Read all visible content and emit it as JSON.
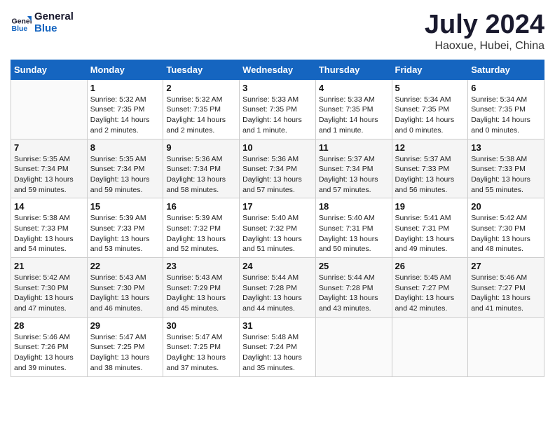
{
  "logo": {
    "line1": "General",
    "line2": "Blue"
  },
  "title": "July 2024",
  "subtitle": "Haoxue, Hubei, China",
  "weekdays": [
    "Sunday",
    "Monday",
    "Tuesday",
    "Wednesday",
    "Thursday",
    "Friday",
    "Saturday"
  ],
  "weeks": [
    [
      {
        "day": "",
        "info": ""
      },
      {
        "day": "1",
        "info": "Sunrise: 5:32 AM\nSunset: 7:35 PM\nDaylight: 14 hours\nand 2 minutes."
      },
      {
        "day": "2",
        "info": "Sunrise: 5:32 AM\nSunset: 7:35 PM\nDaylight: 14 hours\nand 2 minutes."
      },
      {
        "day": "3",
        "info": "Sunrise: 5:33 AM\nSunset: 7:35 PM\nDaylight: 14 hours\nand 1 minute."
      },
      {
        "day": "4",
        "info": "Sunrise: 5:33 AM\nSunset: 7:35 PM\nDaylight: 14 hours\nand 1 minute."
      },
      {
        "day": "5",
        "info": "Sunrise: 5:34 AM\nSunset: 7:35 PM\nDaylight: 14 hours\nand 0 minutes."
      },
      {
        "day": "6",
        "info": "Sunrise: 5:34 AM\nSunset: 7:35 PM\nDaylight: 14 hours\nand 0 minutes."
      }
    ],
    [
      {
        "day": "7",
        "info": "Sunrise: 5:35 AM\nSunset: 7:34 PM\nDaylight: 13 hours\nand 59 minutes."
      },
      {
        "day": "8",
        "info": "Sunrise: 5:35 AM\nSunset: 7:34 PM\nDaylight: 13 hours\nand 59 minutes."
      },
      {
        "day": "9",
        "info": "Sunrise: 5:36 AM\nSunset: 7:34 PM\nDaylight: 13 hours\nand 58 minutes."
      },
      {
        "day": "10",
        "info": "Sunrise: 5:36 AM\nSunset: 7:34 PM\nDaylight: 13 hours\nand 57 minutes."
      },
      {
        "day": "11",
        "info": "Sunrise: 5:37 AM\nSunset: 7:34 PM\nDaylight: 13 hours\nand 57 minutes."
      },
      {
        "day": "12",
        "info": "Sunrise: 5:37 AM\nSunset: 7:33 PM\nDaylight: 13 hours\nand 56 minutes."
      },
      {
        "day": "13",
        "info": "Sunrise: 5:38 AM\nSunset: 7:33 PM\nDaylight: 13 hours\nand 55 minutes."
      }
    ],
    [
      {
        "day": "14",
        "info": "Sunrise: 5:38 AM\nSunset: 7:33 PM\nDaylight: 13 hours\nand 54 minutes."
      },
      {
        "day": "15",
        "info": "Sunrise: 5:39 AM\nSunset: 7:33 PM\nDaylight: 13 hours\nand 53 minutes."
      },
      {
        "day": "16",
        "info": "Sunrise: 5:39 AM\nSunset: 7:32 PM\nDaylight: 13 hours\nand 52 minutes."
      },
      {
        "day": "17",
        "info": "Sunrise: 5:40 AM\nSunset: 7:32 PM\nDaylight: 13 hours\nand 51 minutes."
      },
      {
        "day": "18",
        "info": "Sunrise: 5:40 AM\nSunset: 7:31 PM\nDaylight: 13 hours\nand 50 minutes."
      },
      {
        "day": "19",
        "info": "Sunrise: 5:41 AM\nSunset: 7:31 PM\nDaylight: 13 hours\nand 49 minutes."
      },
      {
        "day": "20",
        "info": "Sunrise: 5:42 AM\nSunset: 7:30 PM\nDaylight: 13 hours\nand 48 minutes."
      }
    ],
    [
      {
        "day": "21",
        "info": "Sunrise: 5:42 AM\nSunset: 7:30 PM\nDaylight: 13 hours\nand 47 minutes."
      },
      {
        "day": "22",
        "info": "Sunrise: 5:43 AM\nSunset: 7:30 PM\nDaylight: 13 hours\nand 46 minutes."
      },
      {
        "day": "23",
        "info": "Sunrise: 5:43 AM\nSunset: 7:29 PM\nDaylight: 13 hours\nand 45 minutes."
      },
      {
        "day": "24",
        "info": "Sunrise: 5:44 AM\nSunset: 7:28 PM\nDaylight: 13 hours\nand 44 minutes."
      },
      {
        "day": "25",
        "info": "Sunrise: 5:44 AM\nSunset: 7:28 PM\nDaylight: 13 hours\nand 43 minutes."
      },
      {
        "day": "26",
        "info": "Sunrise: 5:45 AM\nSunset: 7:27 PM\nDaylight: 13 hours\nand 42 minutes."
      },
      {
        "day": "27",
        "info": "Sunrise: 5:46 AM\nSunset: 7:27 PM\nDaylight: 13 hours\nand 41 minutes."
      }
    ],
    [
      {
        "day": "28",
        "info": "Sunrise: 5:46 AM\nSunset: 7:26 PM\nDaylight: 13 hours\nand 39 minutes."
      },
      {
        "day": "29",
        "info": "Sunrise: 5:47 AM\nSunset: 7:25 PM\nDaylight: 13 hours\nand 38 minutes."
      },
      {
        "day": "30",
        "info": "Sunrise: 5:47 AM\nSunset: 7:25 PM\nDaylight: 13 hours\nand 37 minutes."
      },
      {
        "day": "31",
        "info": "Sunrise: 5:48 AM\nSunset: 7:24 PM\nDaylight: 13 hours\nand 35 minutes."
      },
      {
        "day": "",
        "info": ""
      },
      {
        "day": "",
        "info": ""
      },
      {
        "day": "",
        "info": ""
      }
    ]
  ]
}
